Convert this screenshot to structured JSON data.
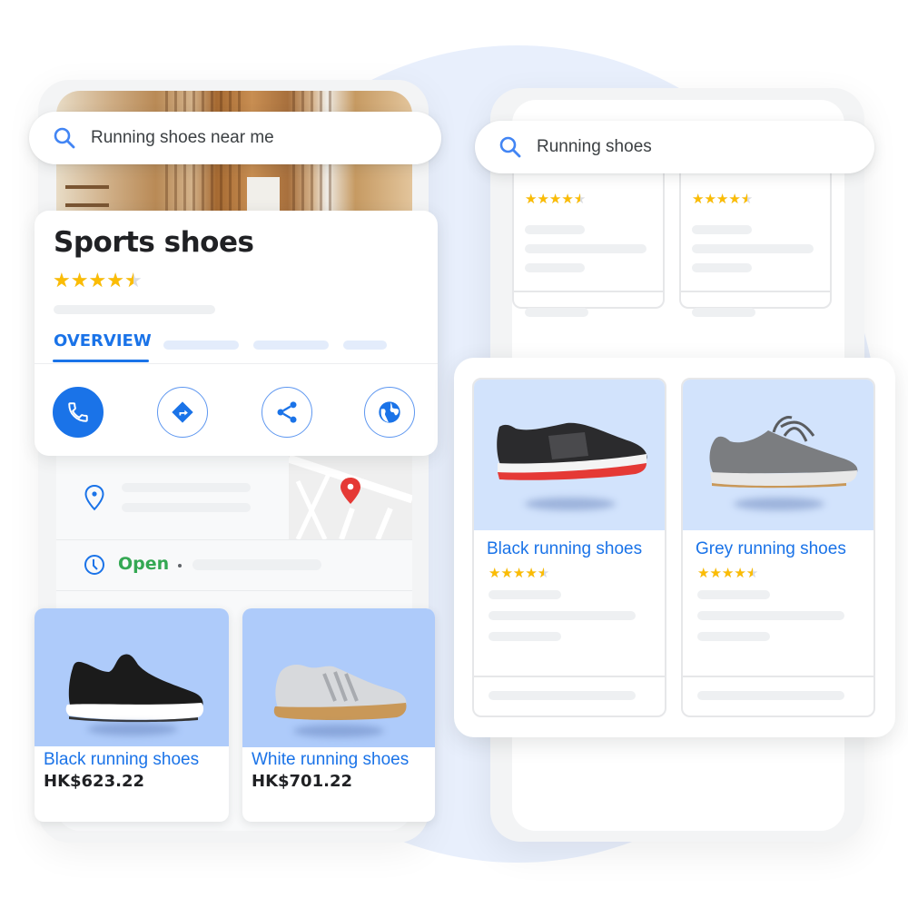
{
  "colors": {
    "accent": "#1a73e8",
    "star": "#fbbc04",
    "open": "#34a853",
    "map_pin": "#e53935",
    "product_bg_left": "#aecbfa",
    "product_bg_right": "#d2e3fc"
  },
  "left_phone": {
    "search": {
      "icon": "search-icon",
      "value": "Running shoes near me"
    },
    "place": {
      "title": "Sports shoes",
      "rating": 4.5,
      "tabs": [
        {
          "label": "OVERVIEW",
          "active": true
        }
      ],
      "actions": [
        {
          "name": "call",
          "icon": "phone-icon",
          "primary": true
        },
        {
          "name": "directions",
          "icon": "directions-icon",
          "primary": false
        },
        {
          "name": "share",
          "icon": "share-icon",
          "primary": false
        },
        {
          "name": "website",
          "icon": "globe-icon",
          "primary": false
        }
      ]
    },
    "info": {
      "address_icon": "location-pin-icon",
      "hours_icon": "clock-icon",
      "status": "Open",
      "separator": "•"
    },
    "products": [
      {
        "name": "Black running shoes",
        "price": "HK$623.22"
      },
      {
        "name": "White running shoes",
        "price": "HK$701.22"
      }
    ]
  },
  "right_phone": {
    "search": {
      "icon": "search-icon",
      "value": "Running shoes"
    },
    "results_top": [
      {
        "rating": 4.5
      },
      {
        "rating": 4.5
      }
    ],
    "products": [
      {
        "name": "Black running shoes",
        "rating": 4.5
      },
      {
        "name": "Grey running shoes",
        "rating": 4.5
      }
    ]
  }
}
